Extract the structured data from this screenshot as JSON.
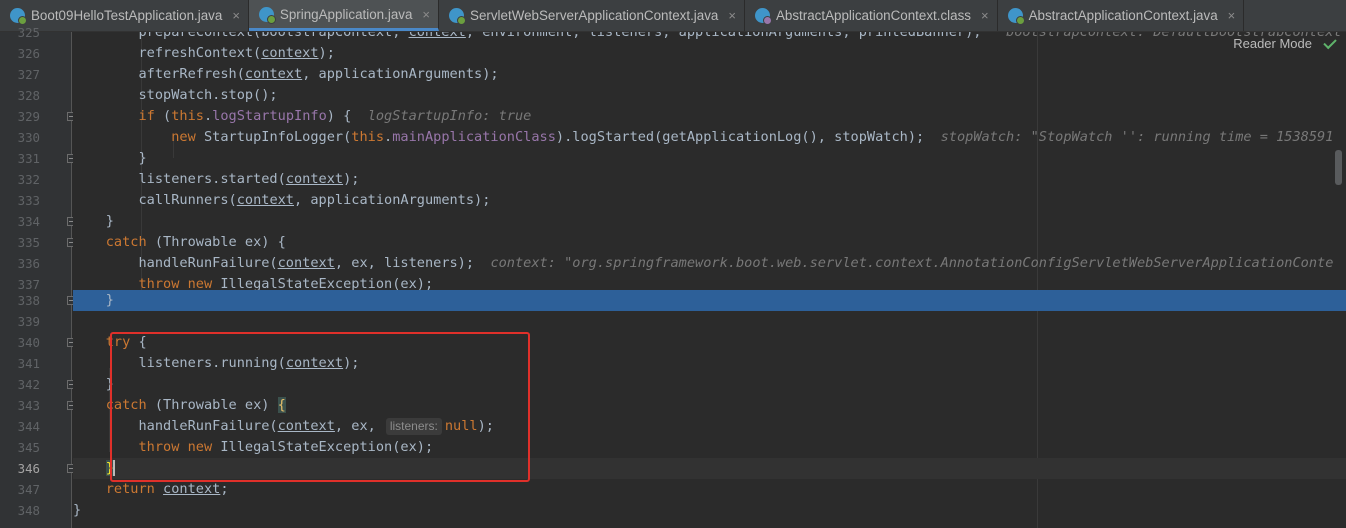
{
  "tabs": [
    {
      "label": "Boot09HelloTestApplication.java",
      "icon": "java-class-icon",
      "active": false
    },
    {
      "label": "SpringApplication.java",
      "icon": "java-class-icon",
      "active": true
    },
    {
      "label": "ServletWebServerApplicationContext.java",
      "icon": "java-class-icon",
      "active": false
    },
    {
      "label": "AbstractApplicationContext.class",
      "icon": "compiled-class-icon",
      "active": false
    },
    {
      "label": "AbstractApplicationContext.java",
      "icon": "java-class-icon",
      "active": false
    }
  ],
  "tab_close_glyph": "×",
  "reader_mode": {
    "label": "Reader Mode"
  },
  "colors": {
    "selection": "#2d6099",
    "keyword": "#cc7832",
    "field": "#9876aa",
    "annotation_box": "#e0302a"
  },
  "line_numbers": [
    "325",
    "326",
    "327",
    "328",
    "329",
    "330",
    "331",
    "332",
    "333",
    "334",
    "335",
    "336",
    "337",
    "338",
    "339",
    "340",
    "341",
    "342",
    "343",
    "344",
    "345",
    "346",
    "347",
    "348"
  ],
  "code": {
    "l325": {
      "a": "prepareContext(bootstrapContext, ",
      "b": "context",
      "c": ", environment, listeners, applicationArguments, printedBanner);",
      "hint": "bootstrapContext: DefaultBootstrapContext"
    },
    "l326": {
      "a": "refreshContext(",
      "b": "context",
      "c": ");"
    },
    "l327": {
      "a": "afterRefresh(",
      "b": "context",
      "c": ", applicationArguments);"
    },
    "l328": {
      "a": "stopWatch.stop();"
    },
    "l329": {
      "kw": "if",
      "a": " (",
      "kw2": "this",
      "b": ".",
      "fld": "logStartupInfo",
      "c": ") {",
      "hint": "logStartupInfo: true"
    },
    "l330": {
      "kw": "new",
      "a": " StartupInfoLogger(",
      "kw2": "this",
      "b": ".",
      "fld": "mainApplicationClass",
      "c": ").logStarted(getApplicationLog(), stopWatch);",
      "hint": "stopWatch: \"StopWatch '': running time = 1538591"
    },
    "l331": {
      "a": "}"
    },
    "l332": {
      "a": "listeners.started(",
      "b": "context",
      "c": ");"
    },
    "l333": {
      "a": "callRunners(",
      "b": "context",
      "c": ", applicationArguments);"
    },
    "l334": {
      "a": "}"
    },
    "l335": {
      "kw": "catch",
      "a": " (Throwable ex) {"
    },
    "l336": {
      "a": "handleRunFailure(",
      "b": "context",
      "c": ", ex, listeners);",
      "hint": "context: \"org.springframework.boot.web.servlet.context.AnnotationConfigServletWebServerApplicationConte"
    },
    "l337": {
      "kw": "throw",
      "kw2": "new",
      "a": " IllegalStateException(ex);"
    },
    "l338": {
      "a": "}"
    },
    "l339": {
      "a": ""
    },
    "l340": {
      "kw": "try",
      "a": " {"
    },
    "l341": {
      "a": "listeners.running(",
      "b": "context",
      "c": ");"
    },
    "l342": {
      "a": "}"
    },
    "l343": {
      "kw": "catch",
      "a": " (Throwable ex) ",
      "brace": "{"
    },
    "l344": {
      "a": "handleRunFailure(",
      "b": "context",
      "c": ", ex,",
      "inlay": "listeners:",
      "kw": "null",
      "d": ");"
    },
    "l345": {
      "kw": "throw",
      "kw2": "new",
      "a": " IllegalStateException(ex);"
    },
    "l346": {
      "brace": "}"
    },
    "l347": {
      "kw": "return",
      "b": "context",
      "c": ";"
    },
    "l348": {
      "a": "}"
    }
  }
}
